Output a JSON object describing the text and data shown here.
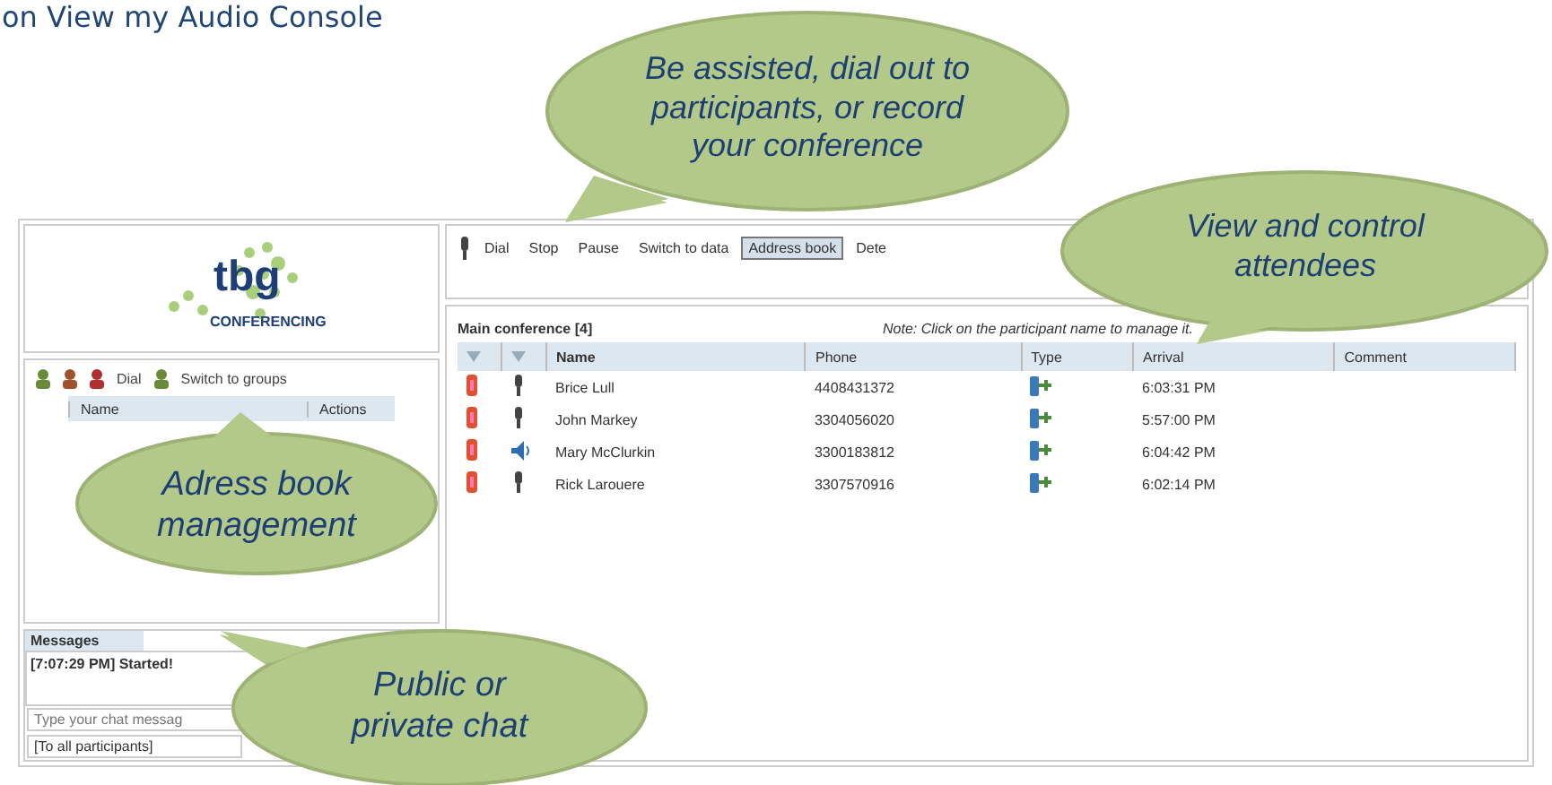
{
  "heading": "on View my Audio Console",
  "logo": {
    "name": "tbg",
    "tagline": "CONFERENCING"
  },
  "address_book": {
    "toolbar": [
      {
        "kind": "icon"
      },
      {
        "kind": "icon"
      },
      {
        "kind": "icon"
      },
      {
        "kind": "button",
        "label": "Dial"
      },
      {
        "kind": "icon"
      },
      {
        "kind": "button",
        "label": "Switch to groups"
      }
    ],
    "columns": [
      "Name",
      "Actions"
    ]
  },
  "messages": {
    "tab": "Messages",
    "log": [
      "[7:07:29 PM] Started!"
    ],
    "input_placeholder": "Type your chat messag",
    "recipient": "[To all participants]"
  },
  "toolbar": [
    {
      "label": "Dial",
      "kind": "button",
      "selected": false
    },
    {
      "label": "Stop",
      "kind": "button",
      "selected": false
    },
    {
      "label": "Pause",
      "kind": "button",
      "selected": false
    },
    {
      "label": "Switch to data",
      "kind": "button",
      "selected": false
    },
    {
      "label": "Address book",
      "kind": "button",
      "selected": true
    },
    {
      "label": "Dete",
      "kind": "button",
      "selected": false
    }
  ],
  "conference": {
    "title": "Main conference [4]",
    "note": "Note: Click on the participant name to manage it.",
    "columns": [
      "Name",
      "Phone",
      "Type",
      "Arrival",
      "Comment"
    ],
    "rows": [
      {
        "name": "Brice Lull",
        "phone": "4408431372",
        "arrival": "6:03:31 PM",
        "talking": false
      },
      {
        "name": "John Markey",
        "phone": "3304056020",
        "arrival": "5:57:00 PM",
        "talking": false
      },
      {
        "name": "Mary McClurkin",
        "phone": "3300183812",
        "arrival": "6:04:42 PM",
        "talking": true
      },
      {
        "name": "Rick Larouere",
        "phone": "3307570916",
        "arrival": "6:02:14 PM",
        "talking": false
      }
    ]
  },
  "callouts": [
    {
      "lines": [
        "Be assisted, dial out to",
        "participants, or record",
        "your conference"
      ]
    },
    {
      "lines": [
        "View and control",
        "attendees"
      ]
    },
    {
      "lines": [
        "Adress book",
        "management"
      ]
    },
    {
      "lines": [
        "Public or",
        "private chat"
      ]
    }
  ]
}
